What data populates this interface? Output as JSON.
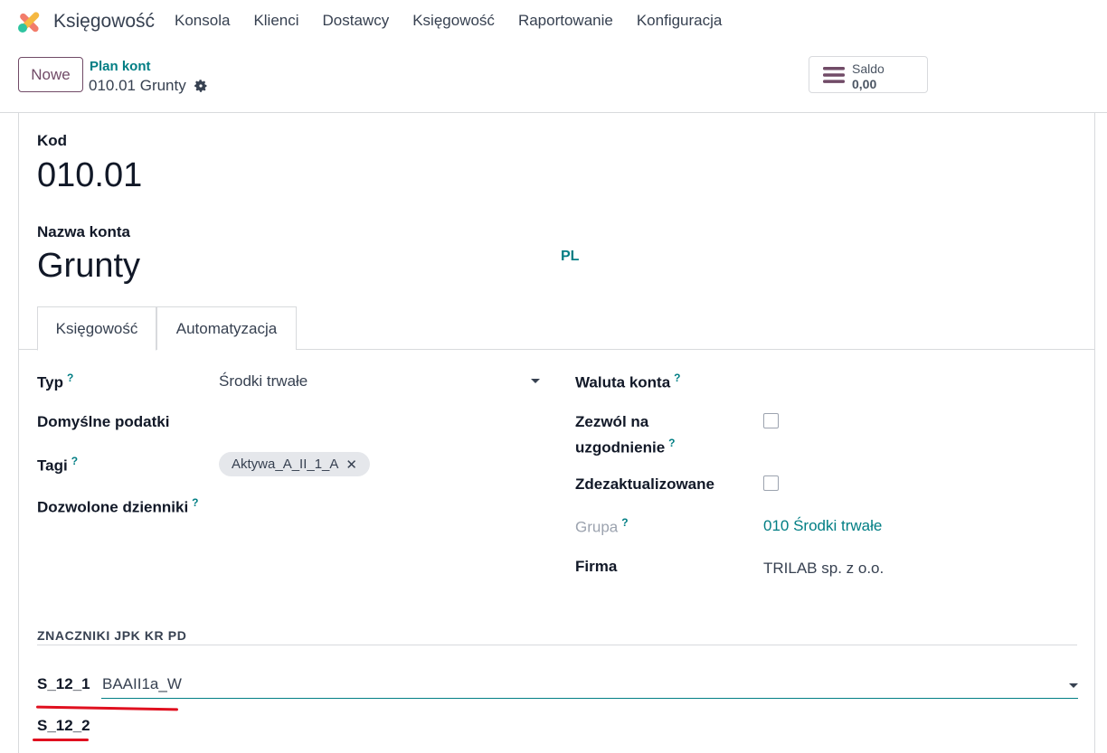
{
  "nav": {
    "app_title": "Księgowość",
    "menu": [
      "Konsola",
      "Klienci",
      "Dostawcy",
      "Księgowość",
      "Raportowanie",
      "Konfiguracja"
    ]
  },
  "control": {
    "new_label": "Nowe",
    "breadcrumb": "Plan kont",
    "record_title": "010.01 Grunty",
    "saldo_label": "Saldo",
    "saldo_value": "0,00"
  },
  "form": {
    "code_label": "Kod",
    "code_value": "010.01",
    "name_label": "Nazwa konta",
    "name_value": "Grunty",
    "lang_badge": "PL",
    "tabs": [
      "Księgowość",
      "Automatyzacja"
    ],
    "left": {
      "type_label": "Typ",
      "type_value": "Środki trwałe",
      "taxes_label": "Domyślne podatki",
      "tags_label": "Tagi",
      "tag_value": "Aktywa_A_II_1_A",
      "journals_label": "Dozwolone dzienniki"
    },
    "right": {
      "currency_label": "Waluta konta",
      "reconcile_label_1": "Zezwól na",
      "reconcile_label_2": "uzgodnienie",
      "deprecated_label": "Zdezaktualizowane",
      "group_label": "Grupa",
      "group_value": "010 Środki trwałe",
      "company_label": "Firma",
      "company_value": "TRILAB sp. z o.o."
    },
    "jpk": {
      "section_title": "ZNACZNIKI JPK KR PD",
      "s12_1_label": "S_12_1",
      "s12_1_value": "BAAII1a_W",
      "s12_2_label": "S_12_2"
    },
    "help_mark": "?"
  },
  "colors": {
    "brand": "#714b67",
    "teal": "#017e84",
    "annotation_red": "#e0101f"
  }
}
